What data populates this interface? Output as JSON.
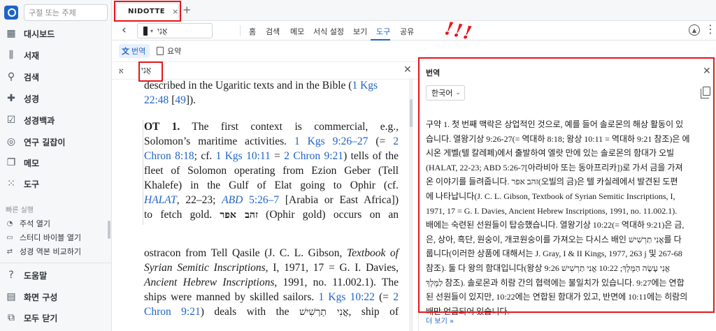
{
  "sidebar": {
    "search_placeholder": "구절 또는 주제",
    "items": [
      {
        "label": "대시보드",
        "icon": "dashboard-icon"
      },
      {
        "label": "서재",
        "icon": "library-icon"
      },
      {
        "label": "검색",
        "icon": "search-icon"
      },
      {
        "label": "성경",
        "icon": "bible-icon"
      },
      {
        "label": "성경백과",
        "icon": "encyclopedia-icon"
      },
      {
        "label": "연구 길잡이",
        "icon": "guide-icon"
      },
      {
        "label": "메모",
        "icon": "notes-icon"
      },
      {
        "label": "도구",
        "icon": "tools-icon"
      }
    ],
    "quick_header": "빠른 실행",
    "quick": [
      {
        "label": "주석 열기",
        "icon": "comment-icon"
      },
      {
        "label": "스터디 바이블 열기",
        "icon": "study-bible-icon"
      },
      {
        "label": "성경 역본 비교하기",
        "icon": "compare-icon"
      }
    ],
    "bottom": [
      {
        "label": "도움말",
        "icon": "help-icon"
      },
      {
        "label": "화면 구성",
        "icon": "layout-icon"
      },
      {
        "label": "모두 닫기",
        "icon": "close-all-icon"
      }
    ]
  },
  "tabs": {
    "doc_label": "NIDOTTE",
    "close": "×",
    "add": "+"
  },
  "toolbar": {
    "resource_word": "אֳנִי",
    "menu": [
      "홈",
      "검색",
      "메모",
      "서식 설정",
      "보기",
      "도구",
      "공유"
    ],
    "active_menu": "도구"
  },
  "subbar": {
    "translate": "번역",
    "summary": "요약"
  },
  "find": {
    "aleph": "א",
    "word": "אֳנִי"
  },
  "main": {
    "top_lines": [
      "described in the Ugaritic texts and in the Bible (1 Kgs",
      "22:48 [49])."
    ],
    "para1": [
      "OT 1. The first context is commercial, e.g.,",
      "Solomon’s maritime activities. 1 Kgs 9:26–27 (= 2",
      "Chron 8:18; cf. 1 Kgs 10:11 = 2 Chron 9:21) tells of the",
      "fleet of Solomon operating from Ezion Geber (Tell",
      "Khalefe) in the Gulf of Elat going to Ophir (cf.",
      "HALAT, 22–23; ABD 5:26–7 [Arabia or East Africa])",
      "to fetch gold. זהב אפר (Ophir gold) occurs on an"
    ],
    "para2": [
      "ostracon from Tell Qasile (J. C. L. Gibson, Textbook of",
      "Syrian Semitic Inscriptions, I, 1971, 17 = G. I. Davies,",
      "Ancient Hebrew Inscriptions, 1991, no. 11.002.1). The",
      "ships were manned by skilled sailors. 1 Kgs 10:22 (= 2",
      "Chron 9:21) deals with the אֳנִי תַרְשִׁישׁ, ship of"
    ]
  },
  "panel": {
    "title": "번역",
    "language": "한국어",
    "translation_lines": [
      "구약 1. 첫 번째 맥락은 상업적인 것으로, 예를 들어 솔로몬의 해상 활동이 있",
      "습니다. 열왕기상 9:26-27(= 역대하 8:18; 왕상 10:11 = 역대하 9:21 참조)은 에",
      "시온 게벨(텔 칼레페)에서 출발하여 엘랏 만에 있는 솔로몬의 함대가 오빌",
      "(HALAT, 22-23; ABD 5:26-7[아라비아 또는 동아프리카])로 가서 금을 가져",
      "온 이야기를 들려줍니다. זהב אפר(오빌의 금)은 텔 카실레에서 발견된 도편",
      "에 나타납니다(J. C. L. Gibson, Textbook of Syrian Semitic Inscriptions, I,",
      "1971, 17 = G. I. Davies, Ancient Hebrew Inscriptions, 1991, no. 11.002.1).",
      "배에는 숙련된 선원들이 탑승했습니다. 열왕기상 10:22(= 역대하 9:21)은 금,",
      "은, 상아, 흑단, 원숭이, 개코원숭이를 가져오는 다시스 배인 אֳנִי תַרְשִׁישׁ를 다",
      "룹니다(이러한 상품에 대해서는 J. Gray, I & II Kings, 1977, 263 j 및 267-68",
      "참조). 둘 다 왕의 함대입니다(왕상 9:26 אֳנִי עָשָׂה הַמֶּלֶךְ; 10:22 אֳנִי תַרְשִׁישׁ",
      "לַמֶּלֶךְ 참조). 솔로몬과 히람 간의 협력에는 불일치가 있습니다. 9:27에는 연합",
      "된 선원들이 있지만, 10:22에는 연합된 함대가 있고, 반면에 10:11에는 히람의",
      "배만 언급되어 있습니다."
    ],
    "more": "더 보기 »"
  },
  "annotation": {
    "marks": "!!!",
    "color": "#e8151a"
  },
  "colors": {
    "accent": "#1f63c7",
    "sidebar_bg": "#f6f7f8"
  }
}
